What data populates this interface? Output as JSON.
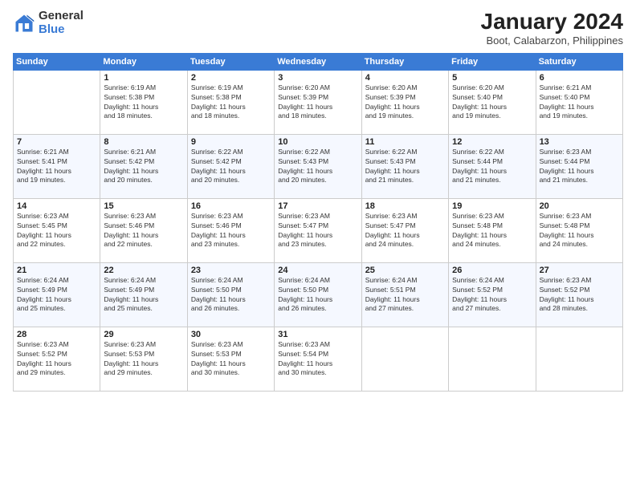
{
  "logo": {
    "general": "General",
    "blue": "Blue"
  },
  "title": "January 2024",
  "subtitle": "Boot, Calabarzon, Philippines",
  "days_header": [
    "Sunday",
    "Monday",
    "Tuesday",
    "Wednesday",
    "Thursday",
    "Friday",
    "Saturday"
  ],
  "weeks": [
    [
      {
        "num": "",
        "info": ""
      },
      {
        "num": "1",
        "info": "Sunrise: 6:19 AM\nSunset: 5:38 PM\nDaylight: 11 hours\nand 18 minutes."
      },
      {
        "num": "2",
        "info": "Sunrise: 6:19 AM\nSunset: 5:38 PM\nDaylight: 11 hours\nand 18 minutes."
      },
      {
        "num": "3",
        "info": "Sunrise: 6:20 AM\nSunset: 5:39 PM\nDaylight: 11 hours\nand 18 minutes."
      },
      {
        "num": "4",
        "info": "Sunrise: 6:20 AM\nSunset: 5:39 PM\nDaylight: 11 hours\nand 19 minutes."
      },
      {
        "num": "5",
        "info": "Sunrise: 6:20 AM\nSunset: 5:40 PM\nDaylight: 11 hours\nand 19 minutes."
      },
      {
        "num": "6",
        "info": "Sunrise: 6:21 AM\nSunset: 5:40 PM\nDaylight: 11 hours\nand 19 minutes."
      }
    ],
    [
      {
        "num": "7",
        "info": "Sunrise: 6:21 AM\nSunset: 5:41 PM\nDaylight: 11 hours\nand 19 minutes."
      },
      {
        "num": "8",
        "info": "Sunrise: 6:21 AM\nSunset: 5:42 PM\nDaylight: 11 hours\nand 20 minutes."
      },
      {
        "num": "9",
        "info": "Sunrise: 6:22 AM\nSunset: 5:42 PM\nDaylight: 11 hours\nand 20 minutes."
      },
      {
        "num": "10",
        "info": "Sunrise: 6:22 AM\nSunset: 5:43 PM\nDaylight: 11 hours\nand 20 minutes."
      },
      {
        "num": "11",
        "info": "Sunrise: 6:22 AM\nSunset: 5:43 PM\nDaylight: 11 hours\nand 21 minutes."
      },
      {
        "num": "12",
        "info": "Sunrise: 6:22 AM\nSunset: 5:44 PM\nDaylight: 11 hours\nand 21 minutes."
      },
      {
        "num": "13",
        "info": "Sunrise: 6:23 AM\nSunset: 5:44 PM\nDaylight: 11 hours\nand 21 minutes."
      }
    ],
    [
      {
        "num": "14",
        "info": "Sunrise: 6:23 AM\nSunset: 5:45 PM\nDaylight: 11 hours\nand 22 minutes."
      },
      {
        "num": "15",
        "info": "Sunrise: 6:23 AM\nSunset: 5:46 PM\nDaylight: 11 hours\nand 22 minutes."
      },
      {
        "num": "16",
        "info": "Sunrise: 6:23 AM\nSunset: 5:46 PM\nDaylight: 11 hours\nand 23 minutes."
      },
      {
        "num": "17",
        "info": "Sunrise: 6:23 AM\nSunset: 5:47 PM\nDaylight: 11 hours\nand 23 minutes."
      },
      {
        "num": "18",
        "info": "Sunrise: 6:23 AM\nSunset: 5:47 PM\nDaylight: 11 hours\nand 24 minutes."
      },
      {
        "num": "19",
        "info": "Sunrise: 6:23 AM\nSunset: 5:48 PM\nDaylight: 11 hours\nand 24 minutes."
      },
      {
        "num": "20",
        "info": "Sunrise: 6:23 AM\nSunset: 5:48 PM\nDaylight: 11 hours\nand 24 minutes."
      }
    ],
    [
      {
        "num": "21",
        "info": "Sunrise: 6:24 AM\nSunset: 5:49 PM\nDaylight: 11 hours\nand 25 minutes."
      },
      {
        "num": "22",
        "info": "Sunrise: 6:24 AM\nSunset: 5:49 PM\nDaylight: 11 hours\nand 25 minutes."
      },
      {
        "num": "23",
        "info": "Sunrise: 6:24 AM\nSunset: 5:50 PM\nDaylight: 11 hours\nand 26 minutes."
      },
      {
        "num": "24",
        "info": "Sunrise: 6:24 AM\nSunset: 5:50 PM\nDaylight: 11 hours\nand 26 minutes."
      },
      {
        "num": "25",
        "info": "Sunrise: 6:24 AM\nSunset: 5:51 PM\nDaylight: 11 hours\nand 27 minutes."
      },
      {
        "num": "26",
        "info": "Sunrise: 6:24 AM\nSunset: 5:52 PM\nDaylight: 11 hours\nand 27 minutes."
      },
      {
        "num": "27",
        "info": "Sunrise: 6:23 AM\nSunset: 5:52 PM\nDaylight: 11 hours\nand 28 minutes."
      }
    ],
    [
      {
        "num": "28",
        "info": "Sunrise: 6:23 AM\nSunset: 5:52 PM\nDaylight: 11 hours\nand 29 minutes."
      },
      {
        "num": "29",
        "info": "Sunrise: 6:23 AM\nSunset: 5:53 PM\nDaylight: 11 hours\nand 29 minutes."
      },
      {
        "num": "30",
        "info": "Sunrise: 6:23 AM\nSunset: 5:53 PM\nDaylight: 11 hours\nand 30 minutes."
      },
      {
        "num": "31",
        "info": "Sunrise: 6:23 AM\nSunset: 5:54 PM\nDaylight: 11 hours\nand 30 minutes."
      },
      {
        "num": "",
        "info": ""
      },
      {
        "num": "",
        "info": ""
      },
      {
        "num": "",
        "info": ""
      }
    ]
  ]
}
